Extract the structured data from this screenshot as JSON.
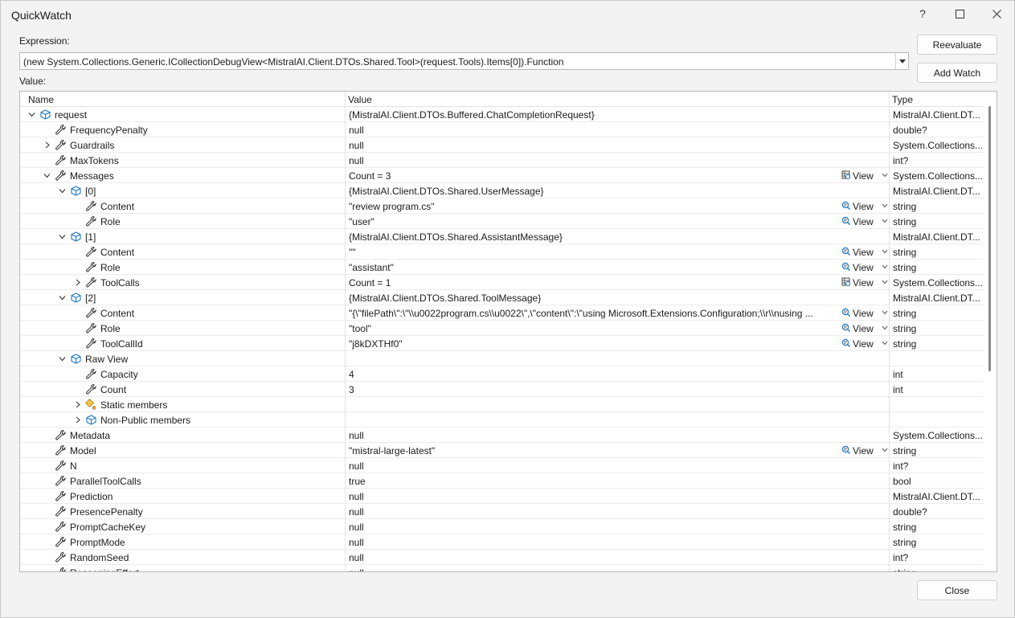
{
  "window": {
    "title": "QuickWatch",
    "help_glyph": "?",
    "maximize_glyph": "☐",
    "close_glyph": "✕"
  },
  "expression": {
    "label": "Expression:",
    "value": "(new System.Collections.Generic.ICollectionDebugView<MistralAI.Client.DTOs.Shared.Tool>(request.Tools).Items[0]).Function"
  },
  "value_label": "Value:",
  "buttons": {
    "reevaluate": "Reevaluate",
    "add_watch": "Add Watch",
    "close": "Close"
  },
  "grid": {
    "columns": [
      "Name",
      "Value",
      "Type"
    ],
    "view_label": "View",
    "rows": [
      {
        "name": "request",
        "value": "{MistralAI.Client.DTOs.Buffered.ChatCompletionRequest}",
        "type": "MistralAI.Client.DT...",
        "level": 0,
        "expander": "expanded",
        "icon": "object-icon",
        "view": ""
      },
      {
        "name": "FrequencyPenalty",
        "value": "null",
        "type": "double?",
        "level": 1,
        "expander": "none",
        "icon": "wrench-icon",
        "view": ""
      },
      {
        "name": "Guardrails",
        "value": "null",
        "type": "System.Collections...",
        "level": 1,
        "expander": "collapsed",
        "icon": "wrench-icon",
        "view": ""
      },
      {
        "name": "MaxTokens",
        "value": "null",
        "type": "int?",
        "level": 1,
        "expander": "none",
        "icon": "wrench-icon",
        "view": ""
      },
      {
        "name": "Messages",
        "value": "Count = 3",
        "type": "System.Collections...",
        "level": 1,
        "expander": "expanded",
        "icon": "wrench-icon",
        "view": "grid"
      },
      {
        "name": "[0]",
        "value": "{MistralAI.Client.DTOs.Shared.UserMessage}",
        "type": "MistralAI.Client.DT...",
        "level": 2,
        "expander": "expanded",
        "icon": "object-icon",
        "view": ""
      },
      {
        "name": "Content",
        "value": "\"review program.cs\"",
        "type": "string",
        "level": 3,
        "expander": "none",
        "icon": "wrench-icon",
        "view": "text"
      },
      {
        "name": "Role",
        "value": "\"user\"",
        "type": "string",
        "level": 3,
        "expander": "none",
        "icon": "wrench-icon",
        "view": "text"
      },
      {
        "name": "[1]",
        "value": "{MistralAI.Client.DTOs.Shared.AssistantMessage}",
        "type": "MistralAI.Client.DT...",
        "level": 2,
        "expander": "expanded",
        "icon": "object-icon",
        "view": ""
      },
      {
        "name": "Content",
        "value": "\"\"",
        "type": "string",
        "level": 3,
        "expander": "none",
        "icon": "wrench-icon",
        "view": "text"
      },
      {
        "name": "Role",
        "value": "\"assistant\"",
        "type": "string",
        "level": 3,
        "expander": "none",
        "icon": "wrench-icon",
        "view": "text"
      },
      {
        "name": "ToolCalls",
        "value": "Count = 1",
        "type": "System.Collections...",
        "level": 3,
        "expander": "collapsed",
        "icon": "wrench-icon",
        "view": "grid"
      },
      {
        "name": "[2]",
        "value": "{MistralAI.Client.DTOs.Shared.ToolMessage}",
        "type": "MistralAI.Client.DT...",
        "level": 2,
        "expander": "expanded",
        "icon": "object-icon",
        "view": ""
      },
      {
        "name": "Content",
        "value": "\"{\\\"filePath\\\":\\\"\\\\u0022program.cs\\\\u0022\\\",\\\"content\\\":\\\"using Microsoft.Extensions.Configuration;\\\\r\\\\nusing ...",
        "type": "string",
        "level": 3,
        "expander": "none",
        "icon": "wrench-icon",
        "view": "text"
      },
      {
        "name": "Role",
        "value": "\"tool\"",
        "type": "string",
        "level": 3,
        "expander": "none",
        "icon": "wrench-icon",
        "view": "text"
      },
      {
        "name": "ToolCallId",
        "value": "\"j8kDXTHf0\"",
        "type": "string",
        "level": 3,
        "expander": "none",
        "icon": "wrench-icon",
        "view": "text"
      },
      {
        "name": "Raw View",
        "value": "",
        "type": "",
        "level": 2,
        "expander": "expanded",
        "icon": "object-icon",
        "view": ""
      },
      {
        "name": "Capacity",
        "value": "4",
        "type": "int",
        "level": 3,
        "expander": "none",
        "icon": "wrench-icon",
        "view": ""
      },
      {
        "name": "Count",
        "value": "3",
        "type": "int",
        "level": 3,
        "expander": "none",
        "icon": "wrench-icon",
        "view": ""
      },
      {
        "name": "Static members",
        "value": "",
        "type": "",
        "level": 3,
        "expander": "collapsed",
        "icon": "static-members-icon",
        "view": ""
      },
      {
        "name": "Non-Public members",
        "value": "",
        "type": "",
        "level": 3,
        "expander": "collapsed",
        "icon": "object-icon",
        "view": ""
      },
      {
        "name": "Metadata",
        "value": "null",
        "type": "System.Collections...",
        "level": 1,
        "expander": "none",
        "icon": "wrench-icon",
        "view": ""
      },
      {
        "name": "Model",
        "value": "\"mistral-large-latest\"",
        "type": "string",
        "level": 1,
        "expander": "none",
        "icon": "wrench-icon",
        "view": "text"
      },
      {
        "name": "N",
        "value": "null",
        "type": "int?",
        "level": 1,
        "expander": "none",
        "icon": "wrench-icon",
        "view": ""
      },
      {
        "name": "ParallelToolCalls",
        "value": "true",
        "type": "bool",
        "level": 1,
        "expander": "none",
        "icon": "wrench-icon",
        "view": ""
      },
      {
        "name": "Prediction",
        "value": "null",
        "type": "MistralAI.Client.DT...",
        "level": 1,
        "expander": "none",
        "icon": "wrench-icon",
        "view": ""
      },
      {
        "name": "PresencePenalty",
        "value": "null",
        "type": "double?",
        "level": 1,
        "expander": "none",
        "icon": "wrench-icon",
        "view": ""
      },
      {
        "name": "PromptCacheKey",
        "value": "null",
        "type": "string",
        "level": 1,
        "expander": "none",
        "icon": "wrench-icon",
        "view": ""
      },
      {
        "name": "PromptMode",
        "value": "null",
        "type": "string",
        "level": 1,
        "expander": "none",
        "icon": "wrench-icon",
        "view": ""
      },
      {
        "name": "RandomSeed",
        "value": "null",
        "type": "int?",
        "level": 1,
        "expander": "none",
        "icon": "wrench-icon",
        "view": ""
      },
      {
        "name": "ReasoningEffort",
        "value": "null",
        "type": "string",
        "level": 1,
        "expander": "none",
        "icon": "wrench-icon",
        "view": ""
      }
    ]
  }
}
